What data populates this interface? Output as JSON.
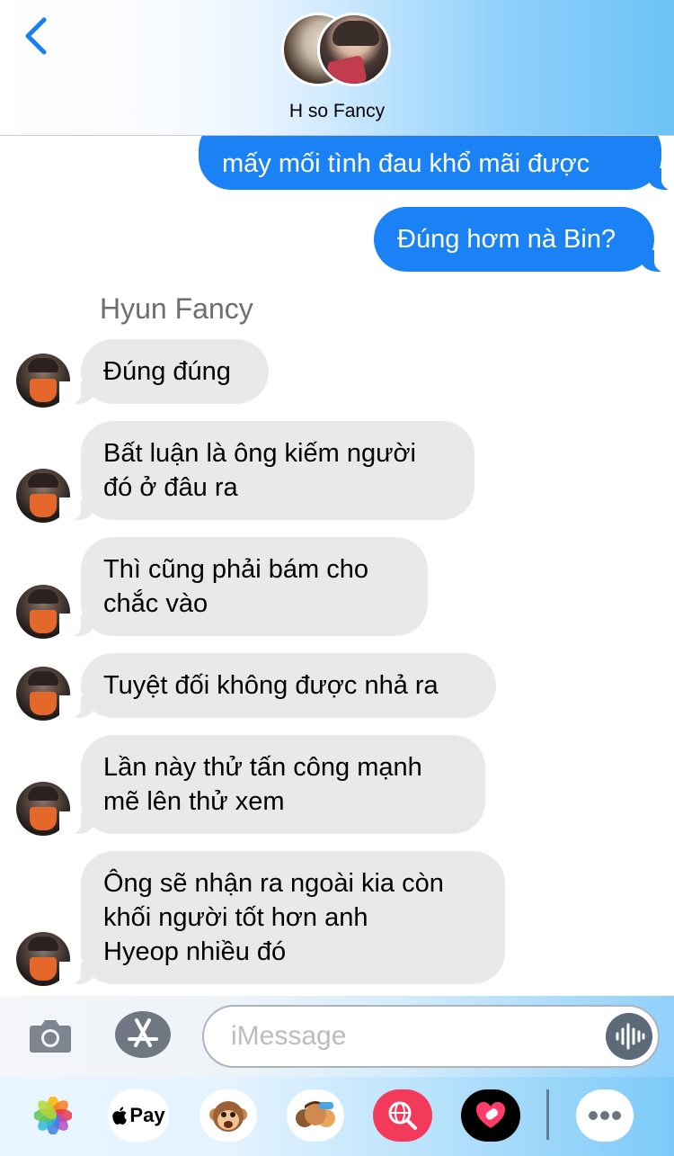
{
  "header": {
    "contact_name": "H so Fancy"
  },
  "messages": {
    "out_1": "mấy mối tình đau khổ mãi được",
    "out_2": "Đúng hơm nà Bin?",
    "sender_name": "Hyun Fancy",
    "in_1": "Đúng đúng",
    "in_2": [
      "Bất luận là ông kiếm người",
      "đó ở đâu ra"
    ],
    "in_3": [
      "Thì cũng phải bám cho",
      "chắc vào"
    ],
    "in_4": "Tuyệt đối không được nhả ra",
    "in_5": [
      "Lần này thử tấn công mạnh",
      "mẽ lên thử xem"
    ],
    "in_6": [
      "Ông sẽ nhận ra ngoài kia còn",
      "khối người tốt hơn anh",
      "Hyeop nhiều đó"
    ]
  },
  "compose": {
    "placeholder": "iMessage"
  },
  "drawer": {
    "applepay_label": "Pay",
    "apps": [
      "photos-icon",
      "apple-pay-icon",
      "animoji-icon",
      "memoji-icon",
      "web-search-icon",
      "digital-touch-icon",
      "more-icon"
    ]
  },
  "colors": {
    "outgoing_bubble": "#1a82f5",
    "incoming_bubble": "#e9e9eb",
    "back_arrow": "#1a7ff0",
    "search_app": "#f43a5a"
  }
}
